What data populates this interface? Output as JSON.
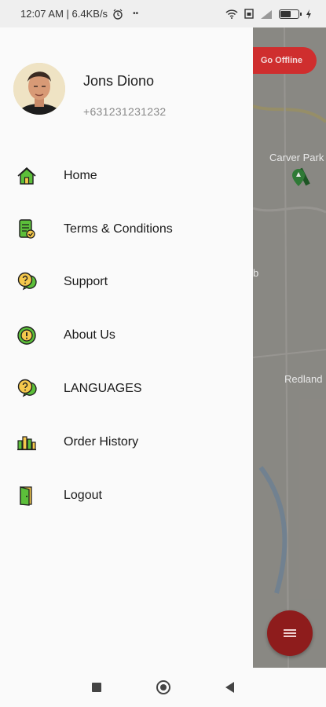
{
  "status_bar": {
    "time_speed": "12:07 AM | 6.4KB/s",
    "dots": "••",
    "battery_level": 0.6
  },
  "map": {
    "labels": [
      "Carver Park",
      "b",
      "Redland"
    ],
    "go_offline_label": "Go Offline"
  },
  "profile": {
    "name": "Jons Diono",
    "phone": "+631231231232"
  },
  "menu": {
    "items": [
      {
        "label": "Home",
        "icon": "home-icon"
      },
      {
        "label": "Terms & Conditions",
        "icon": "document-check-icon"
      },
      {
        "label": "Support",
        "icon": "help-chat-icon"
      },
      {
        "label": "About Us",
        "icon": "info-icon"
      },
      {
        "label": "LANGUAGES",
        "icon": "help-chat-icon"
      },
      {
        "label": "Order History",
        "icon": "bar-chart-icon"
      },
      {
        "label": "Logout",
        "icon": "logout-door-icon"
      }
    ]
  },
  "colors": {
    "accent_red": "#cf2e2e",
    "icon_green": "#3aa83a",
    "icon_yellow": "#f5c84c"
  }
}
